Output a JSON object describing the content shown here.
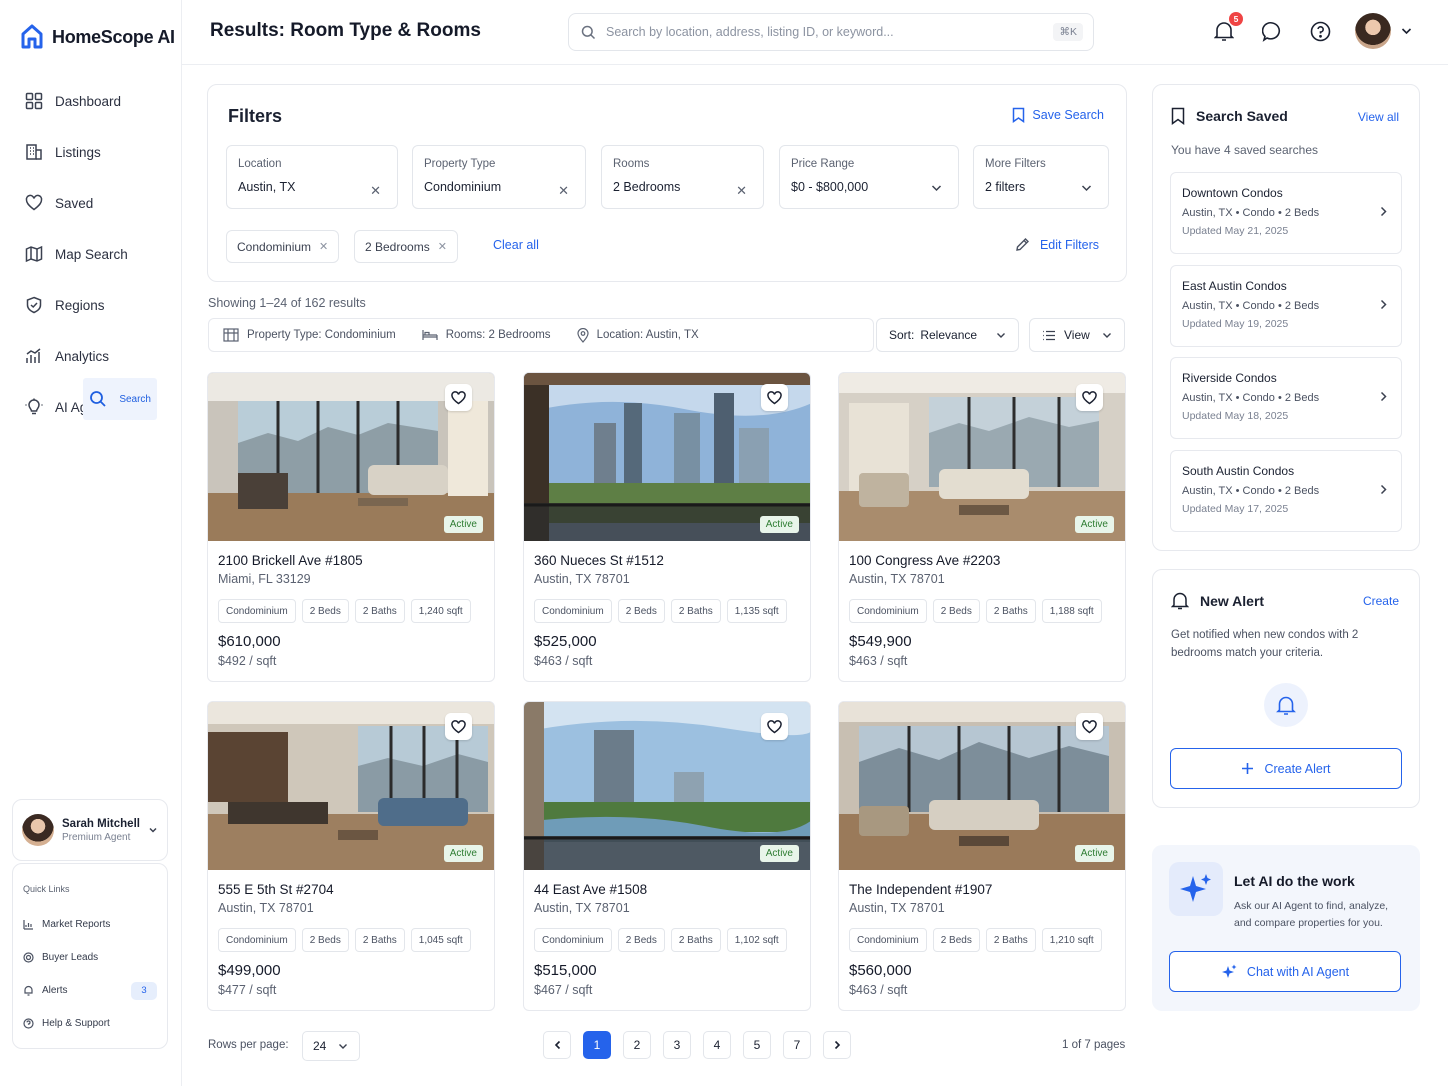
{
  "app": {
    "name": "HomeScope AI",
    "brand_color": "#2563eb"
  },
  "sidebar": {
    "items": [
      {
        "label": "Dashboard",
        "icon": "grid-icon"
      },
      {
        "label": "Search",
        "icon": "search-icon",
        "active": true
      },
      {
        "label": "Listings",
        "icon": "building-icon"
      },
      {
        "label": "Saved",
        "icon": "heart-icon"
      },
      {
        "label": "Map Search",
        "icon": "map-icon"
      },
      {
        "label": "Regions",
        "icon": "shield-icon"
      },
      {
        "label": "Analytics",
        "icon": "analytics-icon"
      },
      {
        "label": "AI Agent",
        "icon": "bulb-icon"
      }
    ],
    "user": {
      "name": "Sarah Mitchell",
      "role": "Premium Agent"
    },
    "quick_links": {
      "title": "Quick Links",
      "items": [
        {
          "label": "Market Reports"
        },
        {
          "label": "Buyer Leads"
        },
        {
          "label": "Alerts",
          "badge": "3"
        },
        {
          "label": "Help & Support"
        }
      ]
    }
  },
  "header": {
    "title": "Results: Room Type & Rooms",
    "search_placeholder": "Search by location, address, listing ID, or keyword...",
    "shortcut": "⌘K",
    "notification_count": "5"
  },
  "filters": {
    "title": "Filters",
    "save_search": "Save Search",
    "boxes": [
      {
        "label": "Location",
        "value": "Austin, TX"
      },
      {
        "label": "Property Type",
        "value": "Condominium"
      },
      {
        "label": "Rooms",
        "value": "2 Bedrooms"
      },
      {
        "label": "Price Range",
        "value": "$0 - $800,000"
      },
      {
        "label": "More Filters",
        "value": "2 filters"
      }
    ],
    "chips": [
      "Condominium",
      "2 Bedrooms"
    ],
    "clear_all": "Clear all",
    "edit": "Edit Filters"
  },
  "results": {
    "showing": "Showing 1–24 of 162 results",
    "crumbs": [
      "Property Type: Condominium",
      "Rooms: 2 Bedrooms",
      "Location: Austin, TX"
    ],
    "sort_label": "Sort:",
    "sort_value": "Relevance",
    "view": "View",
    "listings": [
      {
        "address": "2100 Brickell Ave #1805",
        "city": "Miami, FL 33129",
        "tags": [
          "Condominium",
          "2 Beds",
          "2 Baths",
          "1,240 sqft"
        ],
        "price": "$610,000",
        "psf": "$492 / sqft",
        "status": "Active"
      },
      {
        "address": "360 Nueces St #1512",
        "city": "Austin, TX 78701",
        "tags": [
          "Condominium",
          "2 Beds",
          "2 Baths",
          "1,135 sqft"
        ],
        "price": "$525,000",
        "psf": "$463 / sqft",
        "status": "Active"
      },
      {
        "address": "100 Congress Ave #2203",
        "city": "Austin, TX 78701",
        "tags": [
          "Condominium",
          "2 Beds",
          "2 Baths",
          "1,188 sqft"
        ],
        "price": "$549,900",
        "psf": "$463 / sqft",
        "status": "Active"
      },
      {
        "address": "555 E 5th St #2704",
        "city": "Austin, TX 78701",
        "tags": [
          "Condominium",
          "2 Beds",
          "2 Baths",
          "1,045 sqft"
        ],
        "price": "$499,000",
        "psf": "$477 / sqft",
        "status": "Active"
      },
      {
        "address": "44 East Ave #1508",
        "city": "Austin, TX 78701",
        "tags": [
          "Condominium",
          "2 Beds",
          "2 Baths",
          "1,102 sqft"
        ],
        "price": "$515,000",
        "psf": "$467 / sqft",
        "status": "Active"
      },
      {
        "address": "The Independent #1907",
        "city": "Austin, TX 78701",
        "tags": [
          "Condominium",
          "2 Beds",
          "2 Baths",
          "1,210 sqft"
        ],
        "price": "$560,000",
        "psf": "$463 / sqft",
        "status": "Active"
      }
    ],
    "rows_per_page_label": "Rows per page:",
    "rows_per_page": "24",
    "pages": [
      "1",
      "2",
      "3",
      "4",
      "5",
      "7"
    ],
    "current_page": "1",
    "pages_of": "1 of 7 pages"
  },
  "saved_searches": {
    "title": "Search Saved",
    "view_all": "View all",
    "count_text": "You have 4 saved searches",
    "items": [
      {
        "name": "Downtown Condos",
        "meta": "Austin, TX • Condo • 2 Beds",
        "updated": "Updated May 21, 2025"
      },
      {
        "name": "East Austin Condos",
        "meta": "Austin, TX • Condo • 2 Beds",
        "updated": "Updated May 19, 2025"
      },
      {
        "name": "Riverside Condos",
        "meta": "Austin, TX • Condo • 2 Beds",
        "updated": "Updated May 18, 2025"
      },
      {
        "name": "South Austin Condos",
        "meta": "Austin, TX • Condo • 2 Beds",
        "updated": "Updated May 17, 2025"
      }
    ]
  },
  "new_alert": {
    "title": "New Alert",
    "create": "Create",
    "desc": "Get notified when new condos with 2 bedrooms match your criteria.",
    "button": "Create Alert"
  },
  "ai_promo": {
    "title": "Let AI do the work",
    "desc": "Ask our AI Agent to find, analyze, and compare properties for you.",
    "button": "Chat with AI Agent"
  }
}
